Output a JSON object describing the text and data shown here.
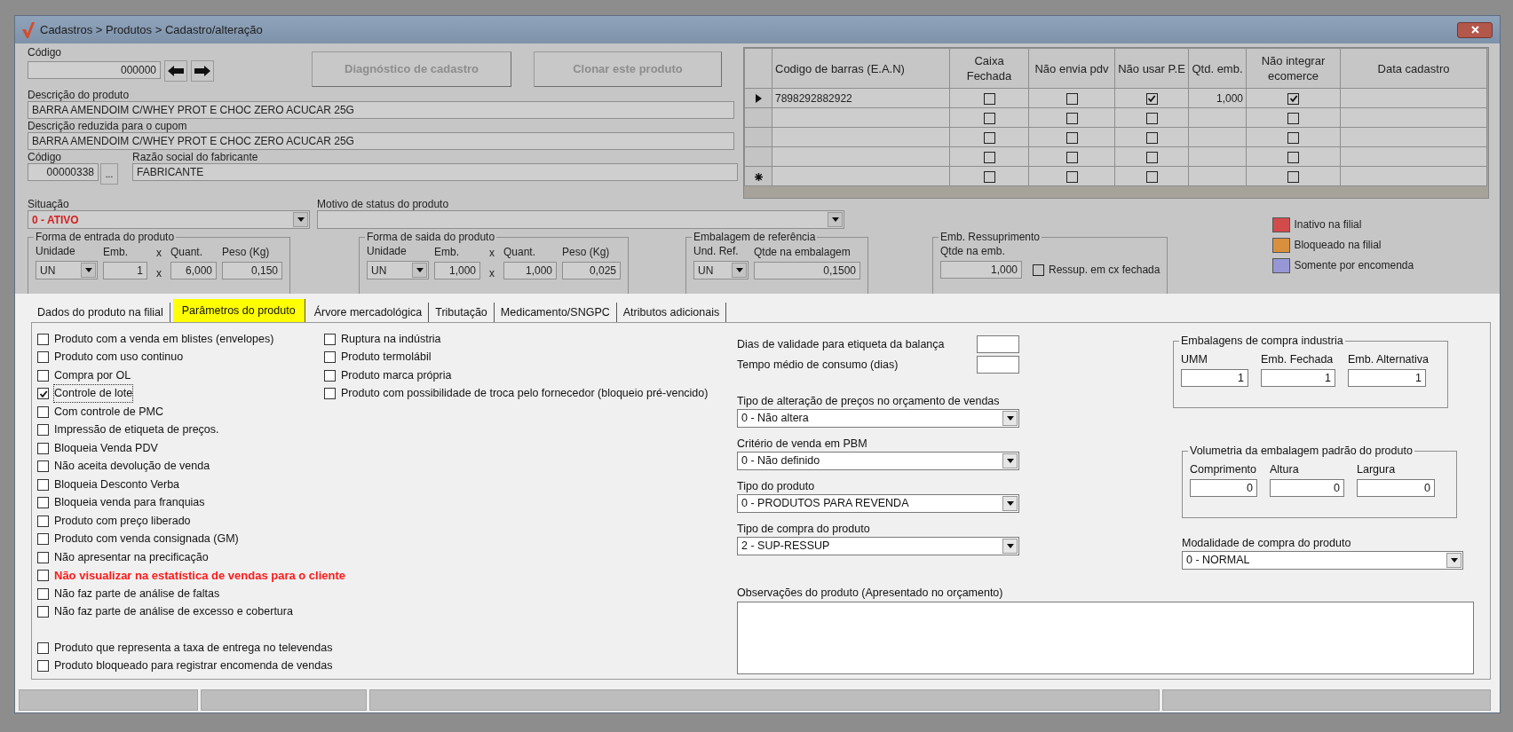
{
  "window": {
    "title": "Cadastros > Produtos > Cadastro/alteração"
  },
  "header": {
    "code": {
      "label": "Código",
      "value": "000000"
    },
    "buttons": [
      {
        "label": "Diagnóstico de cadastro",
        "disabled": true
      },
      {
        "label": "Clonar este produto",
        "disabled": true
      }
    ],
    "description": {
      "label": "Descrição  do produto",
      "value": "BARRA AMENDOIM C/WHEY PROT E CHOC ZERO ACUCAR 25G"
    },
    "short_description": {
      "label": "Descrição reduzida para o cupom",
      "value": "BARRA AMENDOIM C/WHEY PROT E CHOC ZERO ACUCAR 25G"
    },
    "manufacturer_code": {
      "label": "Código",
      "value": "00000338",
      "browse_label": "..."
    },
    "manufacturer_name": {
      "label": "Razão social do fabricante",
      "value": "FABRICANTE"
    },
    "status": {
      "label": "Situação",
      "value": "0 - ATIVO"
    },
    "status_reason": {
      "label": "Motivo de status do produto"
    }
  },
  "barcodes": {
    "columns": [
      "Codigo de barras (E.A.N)",
      "Caixa Fechada",
      "Não envia pdv",
      "Não usar P.E",
      "Qtd. emb.",
      "Não integrar ecomerce",
      "Data cadastro"
    ],
    "rows": [
      {
        "kind": "current",
        "ean": "7898292882922",
        "caixa_fechada": false,
        "nao_envia_pdv": false,
        "nao_usar_pe": true,
        "qtd_emb": "1,000",
        "nao_integrar_ecomerce": true
      },
      {
        "kind": "blank",
        "caixa_fechada": false,
        "nao_envia_pdv": false,
        "nao_usar_pe": false,
        "nao_integrar_ecomerce": false
      },
      {
        "kind": "blank",
        "caixa_fechada": false,
        "nao_envia_pdv": false,
        "nao_usar_pe": false,
        "nao_integrar_ecomerce": false
      },
      {
        "kind": "blank",
        "caixa_fechada": false,
        "nao_envia_pdv": false,
        "nao_usar_pe": false,
        "nao_integrar_ecomerce": false
      },
      {
        "kind": "new",
        "caixa_fechada": false,
        "nao_envia_pdv": false,
        "nao_usar_pe": false,
        "nao_integrar_ecomerce": false
      }
    ]
  },
  "groups": [
    {
      "title": "Forma de entrada do produto",
      "fields": [
        {
          "kind": "select",
          "label": "Unidade",
          "value": "UN"
        },
        {
          "kind": "input",
          "label": "Emb.",
          "value": "1"
        },
        {
          "kind": "times",
          "label": "x",
          "value": "x"
        },
        {
          "kind": "input",
          "label": "Quant.",
          "value": "6,000"
        },
        {
          "kind": "input",
          "label": "Peso (Kg)",
          "value": "0,150"
        }
      ]
    },
    {
      "title": "Forma de saida do produto",
      "fields": [
        {
          "kind": "select",
          "label": "Unidade",
          "value": "UN"
        },
        {
          "kind": "input",
          "label": "Emb.",
          "value": "1,000"
        },
        {
          "kind": "times",
          "label": "x",
          "value": "x"
        },
        {
          "kind": "input",
          "label": "Quant.",
          "value": "1,000"
        },
        {
          "kind": "input",
          "label": "Peso (Kg)",
          "value": "0,025"
        }
      ]
    },
    {
      "title": "Embalagem de referência",
      "fields": [
        {
          "kind": "select",
          "label": "Und. Ref.",
          "value": "UN"
        },
        {
          "kind": "input",
          "label": "Qtde na embalagem",
          "value": "0,1500"
        }
      ]
    },
    {
      "title": "Emb. Ressuprimento",
      "fields": [
        {
          "kind": "input",
          "label": "Qtde na emb.",
          "value": "1,000"
        },
        {
          "kind": "checkbox",
          "label": "Ressup. em cx fechada",
          "checked": false
        }
      ]
    }
  ],
  "legend": [
    {
      "label": "Inativo na filial",
      "color": "#d24b4b"
    },
    {
      "label": "Bloqueado na filial",
      "color": "#d8903f"
    },
    {
      "label": "Somente por encomenda",
      "color": "#9797d6"
    }
  ],
  "tabs": [
    {
      "label": "Dados do produto na filial",
      "selected": false
    },
    {
      "label": "Parâmetros do produto",
      "selected": true
    },
    {
      "label": "Árvore mercadológica",
      "selected": false
    },
    {
      "label": "Tributação",
      "selected": false
    },
    {
      "label": "Medicamento/SNGPC",
      "selected": false
    },
    {
      "label": "Atributos adicionais",
      "selected": false
    }
  ],
  "options": {
    "column_1": [
      {
        "label": "Produto com a venda em blistes (envelopes)",
        "checked": false,
        "highlight": false
      },
      {
        "label": "Produto com uso continuo",
        "checked": false,
        "highlight": false
      },
      {
        "label": "Compra por OL",
        "checked": false,
        "highlight": false
      },
      {
        "label": "Controle de lote",
        "checked": true,
        "highlight": false
      },
      {
        "label": "Com controle de PMC",
        "checked": false,
        "highlight": false
      },
      {
        "label": "Impressão de etiqueta de preços.",
        "checked": false,
        "highlight": false
      },
      {
        "label": "Bloqueia Venda PDV",
        "checked": false,
        "highlight": false
      },
      {
        "label": "Não aceita devolução de venda",
        "checked": false,
        "highlight": false
      },
      {
        "label": "Bloqueia Desconto Verba",
        "checked": false,
        "highlight": false
      },
      {
        "label": "Bloqueia venda para franquias",
        "checked": false,
        "highlight": false
      },
      {
        "label": "Produto com preço liberado",
        "checked": false,
        "highlight": false
      },
      {
        "label": "Produto com venda consignada (GM)",
        "checked": false,
        "highlight": false
      },
      {
        "label": "Não apresentar na precificação",
        "checked": false,
        "highlight": false
      },
      {
        "label": "Não visualizar na estatística de vendas para o cliente",
        "checked": false,
        "highlight": true
      },
      {
        "label": "Não faz parte de análise de faltas",
        "checked": false,
        "highlight": false
      },
      {
        "label": "Não faz parte de análise de excesso e cobertura",
        "checked": false,
        "highlight": false
      }
    ],
    "column_1_bottom": [
      {
        "label": "Produto que representa a taxa de entrega no televendas",
        "checked": false
      },
      {
        "label": "Produto bloqueado para registrar encomenda de vendas",
        "checked": false
      }
    ],
    "column_2": [
      {
        "label": "Ruptura na indústria",
        "checked": false
      },
      {
        "label": "Produto termolábil",
        "checked": false
      },
      {
        "label": "Produto marca própria",
        "checked": false
      },
      {
        "label": "Produto com possibilidade de troca pelo fornecedor (bloqueio pré-vencido)",
        "checked": false
      }
    ]
  },
  "number_fields": [
    {
      "label": "Dias de validade para etiqueta da balança"
    },
    {
      "label": "Tempo médio de consumo (dias)"
    }
  ],
  "selects": [
    {
      "label": "Tipo de alteração de preços no orçamento de vendas",
      "value": "0 - Não altera"
    },
    {
      "label": "Critério de venda em PBM",
      "value": "0 - Não definido"
    },
    {
      "label": "Tipo do produto",
      "value": "0 - PRODUTOS PARA REVENDA"
    },
    {
      "label": "Tipo de compra do produto",
      "value": "2 - SUP-RESSUP"
    }
  ],
  "notes": {
    "label": "Observações do produto (Apresentado no orçamento)"
  },
  "purchase_packs": {
    "title": "Embalagens de compra industria",
    "fields": [
      {
        "label": "UMM",
        "value": "1"
      },
      {
        "label": "Emb. Fechada",
        "value": "1"
      },
      {
        "label": "Emb. Alternativa",
        "value": "1"
      }
    ]
  },
  "volumetry": {
    "title": "Volumetria da embalagem padrão do produto",
    "fields": [
      {
        "label": "Comprimento",
        "value": "0"
      },
      {
        "label": "Altura",
        "value": "0"
      },
      {
        "label": "Largura",
        "value": "0"
      }
    ]
  },
  "purchase_mode": {
    "label": "Modalidade de compra do produto",
    "value": "0 - NORMAL"
  }
}
